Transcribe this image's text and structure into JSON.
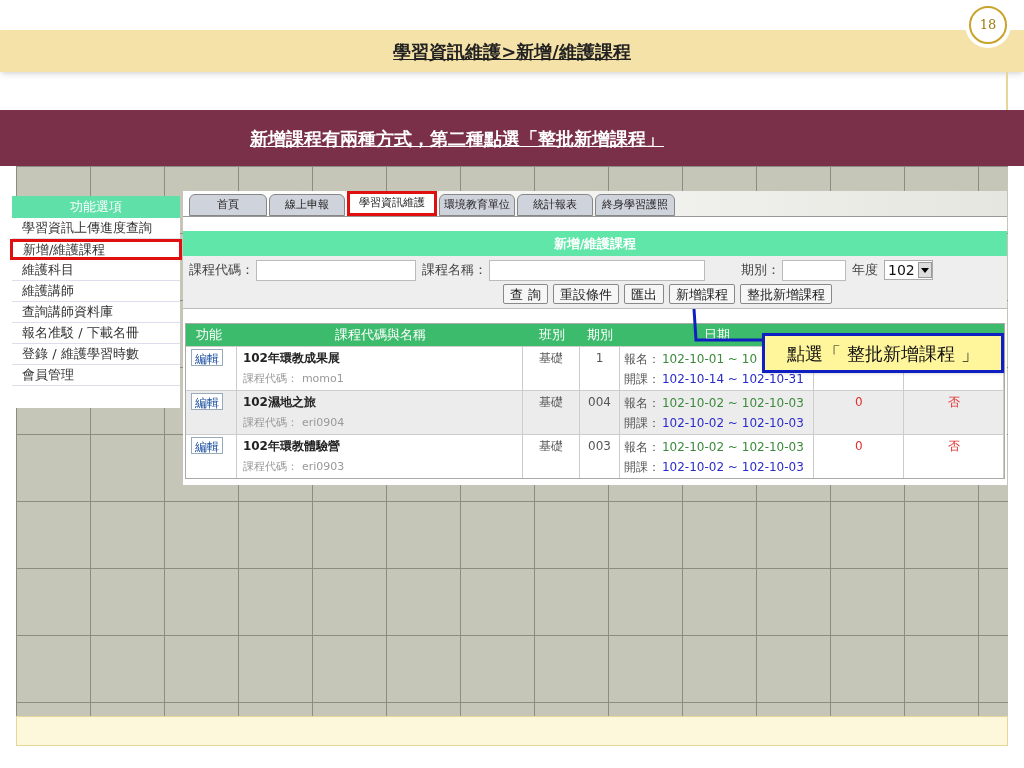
{
  "slide": {
    "title": "學習資訊維護>新增/維護課程",
    "page_number": "18",
    "subtitle": "新增課程有兩種方式，第二種點選「整批新增課程」"
  },
  "sidebar": {
    "title": "功能選項",
    "items": [
      {
        "label": "學習資訊上傳進度查詢",
        "selected": false
      },
      {
        "label": "新增/維護課程",
        "selected": true
      },
      {
        "label": "維護科目",
        "selected": false
      },
      {
        "label": "維護講師",
        "selected": false
      },
      {
        "label": "查詢講師資料庫",
        "selected": false
      },
      {
        "label": "報名准駁 / 下載名冊",
        "selected": false
      },
      {
        "label": "登錄 / 維護學習時數",
        "selected": false
      },
      {
        "label": "會員管理",
        "selected": false
      }
    ]
  },
  "tabs": [
    {
      "label": "首頁",
      "selected": false
    },
    {
      "label": "線上申報",
      "selected": false
    },
    {
      "label": "學習資訊維護",
      "selected": true
    },
    {
      "label": "環境教育單位",
      "selected": false
    },
    {
      "label": "統計報表",
      "selected": false
    },
    {
      "label": "終身學習護照",
      "selected": false
    }
  ],
  "panel": {
    "title": "新增/維護課程",
    "fields": [
      {
        "kind": "text",
        "label": "課程代碼："
      },
      {
        "kind": "text",
        "label": "課程名稱："
      },
      {
        "kind": "text",
        "label": "期別："
      },
      {
        "kind": "select",
        "label": "年度",
        "value": "102"
      }
    ],
    "buttons": [
      "查 詢",
      "重設條件",
      "匯出",
      "新增課程",
      "整批新增課程"
    ]
  },
  "table": {
    "columns": [
      "功能",
      "課程代碼與名稱",
      "班別",
      "期別",
      "日期"
    ],
    "rows": [
      {
        "action": "編輯",
        "name": "102年環教成果展",
        "code_label": "課程代碼：",
        "code": "momo1",
        "class": "基礎",
        "term": "1",
        "enroll_label": "報名：",
        "enroll": "102-10-01 ~ 10",
        "open_label": "開課：",
        "open": "102-10-14 ~ 102-10-31"
      },
      {
        "action": "編輯",
        "name": "102濕地之旅",
        "code_label": "課程代碼：",
        "code": "eri0904",
        "class": "基礎",
        "term": "004",
        "enroll_label": "報名：",
        "enroll": "102-10-02 ~ 102-10-03",
        "open_label": "開課：",
        "open": "102-10-02 ~ 102-10-03",
        "count": "0",
        "subplan": "否"
      },
      {
        "action": "編輯",
        "name": "102年環教體驗營",
        "code_label": "課程代碼：",
        "code": "eri0903",
        "class": "基礎",
        "term": "003",
        "enroll_label": "報名：",
        "enroll": "102-10-02 ~ 102-10-03",
        "open_label": "開課：",
        "open": "102-10-02 ~ 102-10-03",
        "count": "0",
        "subplan": "否"
      }
    ]
  },
  "callout": {
    "text": "點選「 整批新增課程 」"
  }
}
